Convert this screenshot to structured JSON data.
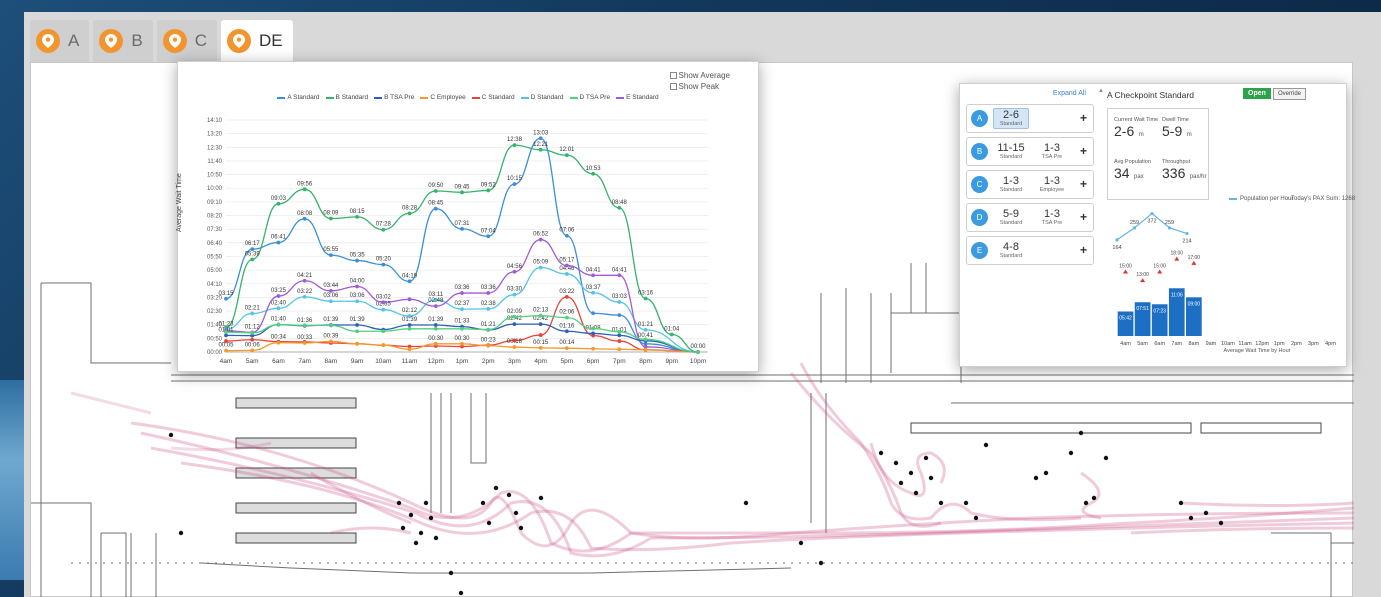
{
  "tabs": [
    {
      "label": "A",
      "active": false
    },
    {
      "label": "B",
      "active": false
    },
    {
      "label": "C",
      "active": false
    },
    {
      "label": "DE",
      "active": true
    }
  ],
  "wait_chart": {
    "toggles": {
      "show_average": "Show Average",
      "show_peak": "Show Peak"
    },
    "y_axis_title": "Average Wait Time",
    "legend": [
      {
        "name": "A Standard",
        "color": "#3b8fd9"
      },
      {
        "name": "B Standard",
        "color": "#35b36b"
      },
      {
        "name": "B TSA Pre",
        "color": "#2f5fb8"
      },
      {
        "name": "C Employee",
        "color": "#f39a2b"
      },
      {
        "name": "C Standard",
        "color": "#e8443a"
      },
      {
        "name": "D Standard",
        "color": "#55c4e8"
      },
      {
        "name": "D TSA Pre",
        "color": "#4fd17f"
      },
      {
        "name": "E Standard",
        "color": "#a05bd6"
      }
    ]
  },
  "chart_data": {
    "type": "line",
    "ylabel": "Average Wait Time",
    "y_ticks": [
      "00:00",
      "00:50",
      "01:40",
      "02:30",
      "03:20",
      "04:10",
      "05:00",
      "05:50",
      "06:40",
      "07:30",
      "08:20",
      "09:10",
      "10:00",
      "10:50",
      "11:40",
      "12:30",
      "13:20",
      "14:10"
    ],
    "ylim_minutes": [
      0,
      850
    ],
    "x": [
      "4am",
      "5am",
      "6am",
      "7am",
      "8am",
      "9am",
      "10am",
      "11am",
      "12pm",
      "1pm",
      "2pm",
      "3pm",
      "4pm",
      "5pm",
      "6pm",
      "7pm",
      "8pm",
      "9pm",
      "10pm"
    ],
    "series": [
      {
        "name": "A Standard",
        "color": "#3b8fd9",
        "values": [
          195,
          377,
          401,
          488,
          355,
          335,
          320,
          259,
          525,
          451,
          424,
          615,
          783,
          426,
          142,
          135,
          30,
          null,
          0
        ],
        "labels": [
          "03:15",
          "06:17",
          "06:41",
          "08:08",
          "05:55",
          "05:35",
          "05:20",
          "04:19",
          "08:45",
          "07:31",
          "07:04",
          "10:15",
          "13:03",
          "07:06",
          "",
          "",
          "",
          "",
          "00:00"
        ]
      },
      {
        "name": "B Standard",
        "color": "#35b36b",
        "values": [
          90,
          339,
          543,
          596,
          489,
          495,
          448,
          508,
          590,
          585,
          592,
          758,
          741,
          721,
          653,
          528,
          196,
          64,
          0
        ],
        "labels": [
          "",
          "05:39",
          "09:03",
          "09:56",
          "08:09",
          "08:15",
          "07:28",
          "08:28",
          "09:50",
          "09:45",
          "09:52",
          "12:38",
          "12:21",
          "12:01",
          "10:53",
          "08:48",
          "03:16",
          "01:04",
          ""
        ]
      },
      {
        "name": "D Standard",
        "color": "#55c4e8",
        "values": [
          83,
          141,
          160,
          202,
          186,
          186,
          155,
          132,
          191,
          157,
          158,
          210,
          309,
          286,
          217,
          183,
          81,
          null,
          0
        ],
        "labels": [
          "01:23",
          "02:21",
          "02:40",
          "03:22",
          "03:06",
          "03:06",
          "02:35",
          "02:12",
          "03:11",
          "02:37",
          "02:38",
          "03:30",
          "05:09",
          "04:46",
          "03:37",
          "03:03",
          "01:21",
          "",
          ""
        ]
      },
      {
        "name": "E Standard",
        "color": "#a05bd6",
        "values": [
          78,
          72,
          205,
          261,
          224,
          240,
          182,
          193,
          168,
          216,
          216,
          294,
          412,
          317,
          281,
          281,
          19,
          null,
          0
        ],
        "labels": [
          "",
          "01:12",
          "03:25",
          "04:21",
          "03:44",
          "04:00",
          "03:02",
          "",
          "02:48",
          "03:36",
          "03:36",
          "04:56",
          "06:52",
          "05:17",
          "04:41",
          "04:41",
          "",
          "",
          ""
        ]
      },
      {
        "name": "C Standard",
        "color": "#e8443a",
        "values": [
          40,
          45,
          38,
          37,
          33,
          30,
          25,
          20,
          22,
          20,
          25,
          42,
          62,
          202,
          60,
          40,
          8,
          null,
          0
        ],
        "labels": [
          "",
          "",
          "",
          "",
          "",
          "",
          "",
          "",
          "",
          "",
          "",
          "",
          "",
          "03:22",
          "",
          "",
          "",
          "",
          ""
        ]
      },
      {
        "name": "C Employee",
        "color": "#f39a2b",
        "values": [
          5,
          6,
          34,
          33,
          39,
          30,
          25,
          10,
          30,
          30,
          23,
          18,
          15,
          14,
          12,
          10,
          8,
          null,
          0
        ],
        "labels": [
          "00:05",
          "00:06",
          "00:34",
          "00:33",
          "00:39",
          "",
          "",
          "",
          "00:30",
          "00:30",
          "00:23",
          "00:18",
          "00:15",
          "00:14",
          "",
          "",
          "",
          "",
          ""
        ]
      },
      {
        "name": "B TSA Pre",
        "color": "#2f5fb8",
        "values": [
          61,
          60,
          100,
          96,
          99,
          99,
          82,
          99,
          99,
          93,
          81,
          102,
          102,
          76,
          68,
          61,
          41,
          null,
          0
        ],
        "labels": [
          "01:01",
          "",
          "01:40",
          "01:36",
          "01:39",
          "01:39",
          "",
          "01:39",
          "01:39",
          "01:33",
          "01:21",
          "02:42",
          "02:42",
          "01:16",
          "01:08",
          "01:01",
          "00:41",
          "",
          ""
        ]
      },
      {
        "name": "D TSA Pre",
        "color": "#4fd17f",
        "values": [
          73,
          70,
          100,
          98,
          97,
          76,
          76,
          85,
          85,
          85,
          82,
          129,
          133,
          126,
          86,
          74,
          46,
          null,
          0
        ],
        "labels": [
          "",
          "",
          "",
          "",
          "",
          "",
          "",
          "",
          "",
          "",
          "",
          "02:09",
          "02:13",
          "02:06",
          "",
          "",
          "",
          "",
          ""
        ]
      }
    ]
  },
  "checkpoint": {
    "expand_all": "Expand All",
    "rows": [
      {
        "id": "A",
        "cells": [
          {
            "value": "2-6",
            "label": "Standard",
            "selected": true
          }
        ]
      },
      {
        "id": "B",
        "cells": [
          {
            "value": "11-15",
            "label": "Standard"
          },
          {
            "value": "1-3",
            "label": "TSA Pre"
          }
        ]
      },
      {
        "id": "C",
        "cells": [
          {
            "value": "1-3",
            "label": "Standard"
          },
          {
            "value": "1-3",
            "label": "Employee"
          }
        ]
      },
      {
        "id": "D",
        "cells": [
          {
            "value": "5-9",
            "label": "Standard"
          },
          {
            "value": "1-3",
            "label": "TSA Pre"
          }
        ]
      },
      {
        "id": "E",
        "cells": [
          {
            "value": "4-8",
            "label": "Standard"
          }
        ]
      }
    ],
    "plus": "+",
    "title": "A Checkpoint Standard",
    "status": "Open",
    "override_label": "Override",
    "stats": {
      "current_wait_label": "Current Wait Time",
      "current_wait_value": "2-6",
      "current_wait_unit": "m",
      "dwell_label": "Dwell Time",
      "dwell_value": "5-9",
      "dwell_unit": "m",
      "avg_pop_label": "Avg Population",
      "avg_pop_value": "34",
      "avg_pop_unit": "pax",
      "throughput_label": "Throughput",
      "throughput_value": "336",
      "throughput_unit": "pax/hr"
    },
    "population_legend": "Population per Hour",
    "pax_sum": "Today's PAX Sum: 1268",
    "population": {
      "x": [
        "4am",
        "5am",
        "6am",
        "7am",
        "8am"
      ],
      "values": [
        164,
        259,
        372,
        259,
        214
      ]
    },
    "bars": {
      "x_labels": [
        "4am",
        "5am",
        "6am",
        "7am",
        "8am",
        "9am",
        "10am",
        "11am",
        "12pm",
        "1pm",
        "2pm",
        "3pm",
        "4pm"
      ],
      "values": [
        5.7,
        7.85,
        7.38,
        11.1,
        9.0
      ],
      "value_labels": [
        "05:42",
        "07:51",
        "07:23",
        "11:06",
        "09:00"
      ],
      "peaks": [
        15.0,
        13.0,
        15.0,
        18.0,
        17.0
      ],
      "peak_labels": [
        "15:00",
        "13:00",
        "15:00",
        "18:00",
        "17:00"
      ],
      "xlabel": "Average Wait Time by Hour"
    }
  },
  "colors": {
    "accent": "#f2952f",
    "open_green": "#2ca24a",
    "checkpoint_blue": "#3b9be0",
    "bar_blue": "#1d6fc4",
    "heat": "#c8487e"
  }
}
